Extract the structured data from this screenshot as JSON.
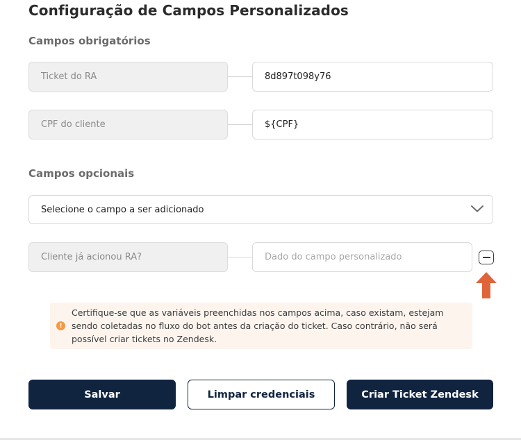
{
  "page": {
    "title": "Configuração de Campos Personalizados"
  },
  "required_section": {
    "title": "Campos obrigatórios",
    "fields": [
      {
        "label": "Ticket do RA",
        "value": "8d897t098y76"
      },
      {
        "label": "CPF do cliente",
        "value": "${CPF}"
      }
    ]
  },
  "optional_section": {
    "title": "Campos opcionais",
    "select_placeholder": "Selecione o campo a ser adicionado",
    "fields": [
      {
        "label": "Cliente já acionou RA?",
        "value": "",
        "placeholder": "Dado do campo personalizado"
      }
    ]
  },
  "alert": {
    "icon": "warning-icon",
    "color": "#f29a45",
    "text": "Certifique-se que as variáveis preenchidas nos campos acima, caso existam, estejam sendo coletadas no fluxo do bot antes da criação do ticket. Caso contrário, não será possível criar tickets no Zendesk."
  },
  "actions": {
    "save_label": "Salvar",
    "clear_label": "Limpar credenciais",
    "create_label": "Criar Ticket Zendesk"
  },
  "colors": {
    "primary": "#102440",
    "annotation_arrow": "#e0643a"
  }
}
